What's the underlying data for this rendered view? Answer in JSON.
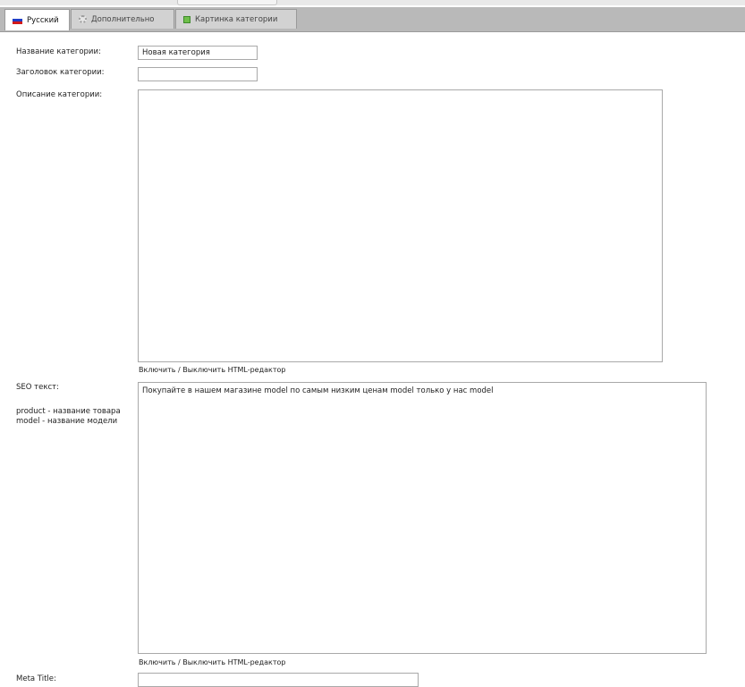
{
  "colors": {
    "tabbar_bg": "#b9b9b9",
    "tab_inactive_bg": "#d2d2d2",
    "active_tab_bg": "#ffffff",
    "field_border": "#a9a9a9",
    "flag": [
      "#ffffff",
      "#1f3fc8",
      "#d21a1a"
    ]
  },
  "tabs": [
    {
      "label": "Русский",
      "icon": "russian-flag-icon",
      "active": true
    },
    {
      "label": "Дополнительно",
      "icon": "gear-icon",
      "active": false
    },
    {
      "label": "Картинка категории",
      "icon": "image-icon",
      "active": false
    }
  ],
  "form": {
    "name_label": "Название категории:",
    "name_value": "Новая категория",
    "heading_label": "Заголовок категории:",
    "heading_value": "",
    "description_label": "Описание категории:",
    "description_value": "",
    "description_toggle": "Включить / Выключить HTML-редактор",
    "seo_label": "SEO текст:",
    "seo_hint_1": "product - название товара",
    "seo_hint_2": "model - название модели",
    "seo_value": "Покупайте в нашем магазине model по самым низким ценам model только у нас model",
    "seo_toggle": "Включить / Выключить HTML-редактор",
    "meta_title_label": "Meta Title:",
    "meta_title_value": ""
  }
}
